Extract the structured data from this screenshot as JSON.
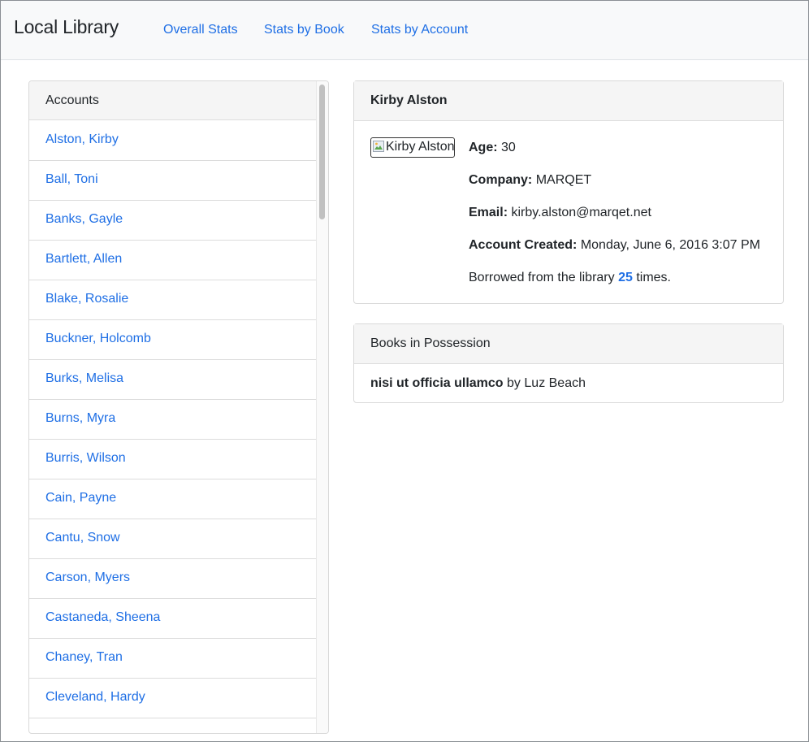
{
  "navbar": {
    "brand": "Local Library",
    "links": [
      "Overall Stats",
      "Stats by Book",
      "Stats by Account"
    ]
  },
  "accounts": {
    "header": "Accounts",
    "items": [
      "Alston, Kirby",
      "Ball, Toni",
      "Banks, Gayle",
      "Bartlett, Allen",
      "Blake, Rosalie",
      "Buckner, Holcomb",
      "Burks, Melisa",
      "Burns, Myra",
      "Burris, Wilson",
      "Cain, Payne",
      "Cantu, Snow",
      "Carson, Myers",
      "Castaneda, Sheena",
      "Chaney, Tran",
      "Cleveland, Hardy"
    ]
  },
  "detail": {
    "name": "Kirby Alston",
    "image_alt": "Kirby Alston",
    "age_label": "Age:",
    "age": "30",
    "company_label": "Company:",
    "company": "MARQET",
    "email_label": "Email:",
    "email": "kirby.alston@marqet.net",
    "created_label": "Account Created:",
    "created": "Monday, June 6, 2016 3:07 PM",
    "borrowed_prefix": "Borrowed from the library",
    "borrowed_count": "25",
    "borrowed_suffix": "times."
  },
  "books": {
    "header": "Books in Possession",
    "items": [
      {
        "title": "nisi ut officia ullamco",
        "by": "by",
        "author": "Luz Beach"
      }
    ]
  },
  "colors": {
    "link": "#1f6fe5",
    "navbar_bg": "#f8f9fa",
    "card_header_bg": "#f5f5f5"
  }
}
